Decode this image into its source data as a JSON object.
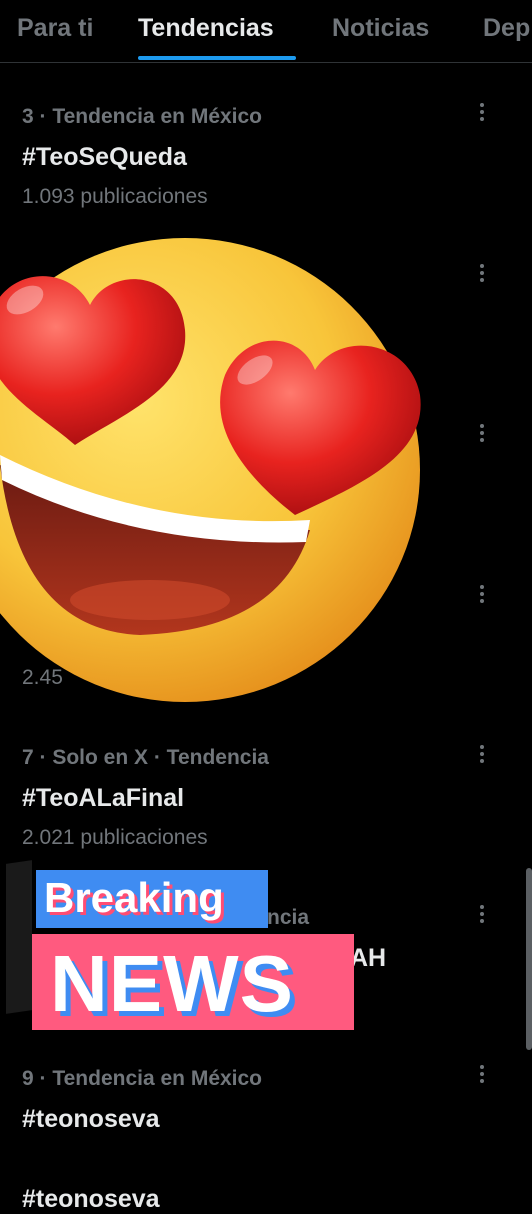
{
  "tabs": [
    {
      "label": "Para ti",
      "active": false
    },
    {
      "label": "Tendencias",
      "active": true
    },
    {
      "label": "Noticias",
      "active": false
    },
    {
      "label": "Dep",
      "active": false
    }
  ],
  "trends": [
    {
      "meta": "3 · Tendencia en México",
      "name": "#TeoSeQueda",
      "count": "1.093 publicaciones"
    },
    {
      "meta": "",
      "name": "",
      "count": ""
    },
    {
      "meta": "",
      "name": "",
      "count": ""
    },
    {
      "meta": "",
      "name": "",
      "count": "2.45"
    },
    {
      "meta": "7 · Solo en X · Tendencia",
      "name": "#TeoALaFinal",
      "count": "2.021 publicaciones"
    },
    {
      "meta": "ncia",
      "name": "AH",
      "count": ""
    },
    {
      "meta": "9 · Tendencia en México",
      "name": "#teonoseva",
      "count": ""
    }
  ],
  "partial_row_text": "#teonoseva",
  "overlay": {
    "emoji": "heart-eyes-emoji",
    "breaking_top": "Breaking",
    "breaking_bottom": "NEWS"
  },
  "colors": {
    "accent": "#1d9bf0",
    "muted": "#71767b",
    "breaking_blue": "#3f8cf2",
    "breaking_pink": "#ff5a7f"
  }
}
